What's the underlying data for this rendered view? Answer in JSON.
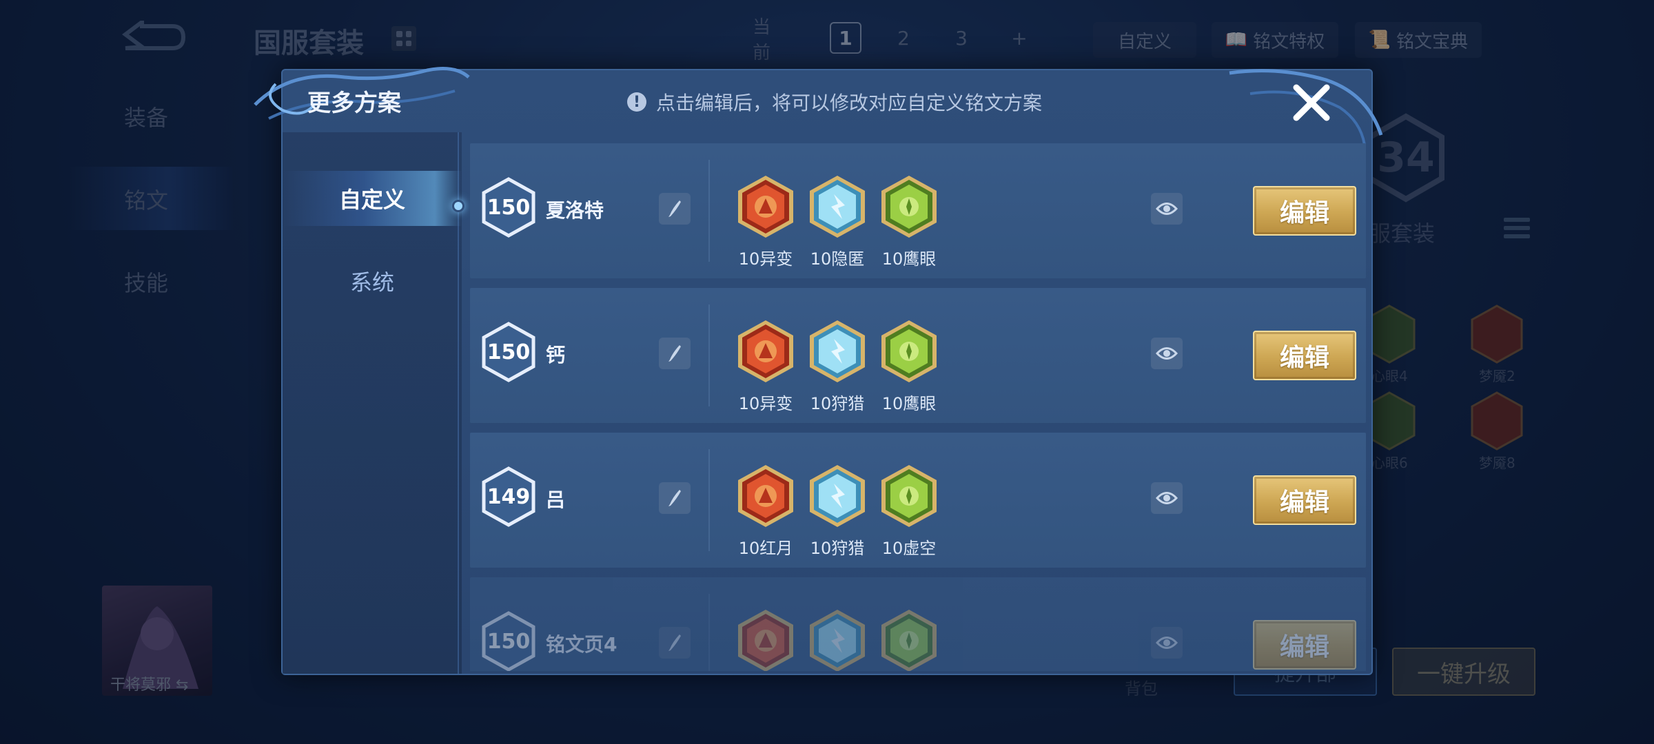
{
  "background": {
    "title": "国服套装",
    "nav": [
      "装备",
      "铭文",
      "技能"
    ],
    "current_label": "当前",
    "pages": [
      "1",
      "2",
      "3",
      "+"
    ],
    "custom_btn": "自定义",
    "privilege_btn": "铭文特权",
    "codex_btn": "铭文宝典",
    "suit_number": "34",
    "suit_label": "服套装",
    "rune_labels": [
      "心眼4",
      "梦魇2",
      "心眼6",
      "梦魇8"
    ],
    "hero_name": "干将莫邪",
    "bag_label": "背包",
    "upgrade_a": "提升部",
    "upgrade_b": "一键升级"
  },
  "modal": {
    "title": "更多方案",
    "hint": "点击编辑后，将可以修改对应自定义铭文方案",
    "tabs": [
      {
        "label": "自定义",
        "active": true
      },
      {
        "label": "系统",
        "active": false
      }
    ],
    "edit_label": "编辑",
    "schemes": [
      {
        "level": "150",
        "name": "夏洛特",
        "runes": [
          {
            "count": "10异变",
            "icon": "red-rune-icon"
          },
          {
            "count": "10隐匿",
            "icon": "blue-rune-icon"
          },
          {
            "count": "10鹰眼",
            "icon": "green-rune-icon"
          }
        ]
      },
      {
        "level": "150",
        "name": "钙",
        "runes": [
          {
            "count": "10异变",
            "icon": "red-rune-icon"
          },
          {
            "count": "10狩猎",
            "icon": "blue-rune-icon"
          },
          {
            "count": "10鹰眼",
            "icon": "green-rune-icon"
          }
        ]
      },
      {
        "level": "149",
        "name": "吕",
        "runes": [
          {
            "count": "10红月",
            "icon": "red-rune-icon"
          },
          {
            "count": "10狩猎",
            "icon": "blue-rune-icon"
          },
          {
            "count": "10虚空",
            "icon": "green-rune-icon"
          }
        ]
      },
      {
        "level": "150",
        "name": "铭文页4",
        "runes": [
          {
            "count": "",
            "icon": "red-rune-icon"
          },
          {
            "count": "",
            "icon": "blue-rune-icon"
          },
          {
            "count": "",
            "icon": "green-rune-icon"
          }
        ]
      }
    ]
  },
  "colors": {
    "accent_gold": "#cda653",
    "panel_blue": "#2f4e7a",
    "red_rune": "#c8422a",
    "blue_rune": "#7fc4e6",
    "green_rune": "#7fae3a"
  }
}
